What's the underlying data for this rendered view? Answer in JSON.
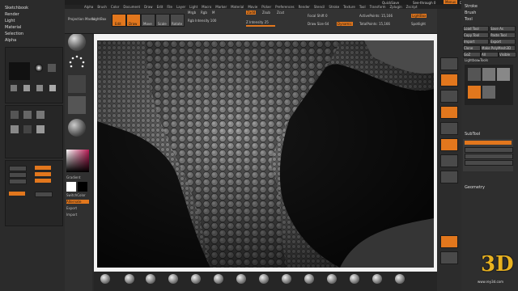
{
  "top_menu": [
    "ZBrush 4R6",
    "Alpha",
    "Brush",
    "Color",
    "Document",
    "Draw",
    "Edit",
    "File",
    "Layer",
    "Light",
    "Macro",
    "Marker",
    "Material",
    "Movie",
    "Picker",
    "Preferences",
    "Render",
    "Stencil",
    "Stroke",
    "Texture",
    "Tool",
    "Transform",
    "Zplugin",
    "Zscript"
  ],
  "top_right": {
    "quicksave": "QuickSave",
    "see_through": "See-through 0",
    "menus": "Menus",
    "default_script": "DefaultZScript"
  },
  "left_menu": [
    "Sketchbook",
    "Render",
    "Light",
    "Material",
    "Selection",
    "Alpha"
  ],
  "lightbox": {
    "label": "LightBox",
    "spotlight": "Spotlight"
  },
  "toolbar": {
    "projection_master": "Projection Master",
    "lightbox": "LightBox",
    "edit": "Edit",
    "draw": "Draw",
    "move": "Move",
    "scale": "Scale",
    "rotate": "Rotate",
    "mrgb": "Mrgb",
    "rgb": "Rgb",
    "m": "M",
    "zadd": "Zadd",
    "zsub": "Zsub",
    "zcut": "Zcut",
    "rgb_intensity": "Rgb Intensity 100",
    "z_intensity": "Z Intensity 25",
    "focal_shift": "Focal Shift 0",
    "draw_size": "Draw Size 64",
    "dynamic": "Dynamic",
    "active_points": "ActivePoints: 15,166",
    "total_points": "TotalPoints: 15,166"
  },
  "left_panel": {
    "gradient": "Gradient",
    "switch_color": "SwitchColor",
    "alternate": "Alternate",
    "export": "Export",
    "import": "Import"
  },
  "right_panel": {
    "tool": "Tool",
    "load_tool": "Load Tool",
    "save_as": "Save As",
    "copy_tool": "Copy Tool",
    "paste_tool": "Paste Tool",
    "import": "Import",
    "export": "Export",
    "clone": "Clone",
    "make_polymesh": "Make PolyMesh3D",
    "goz": "GoZ",
    "all": "All",
    "visible": "Visible",
    "lightbox_tools": "Lightbox▸Tools",
    "subtool": "SubTool",
    "geometry": "Geometry",
    "stroke": "Stroke",
    "brush": "Brush"
  },
  "watermark": {
    "logo": "3D",
    "site": "www.rey3d.com"
  },
  "colors": {
    "accent": "#e2771d",
    "panel": "#2e2e2e",
    "canvas_frame": "#f2f2f2"
  }
}
